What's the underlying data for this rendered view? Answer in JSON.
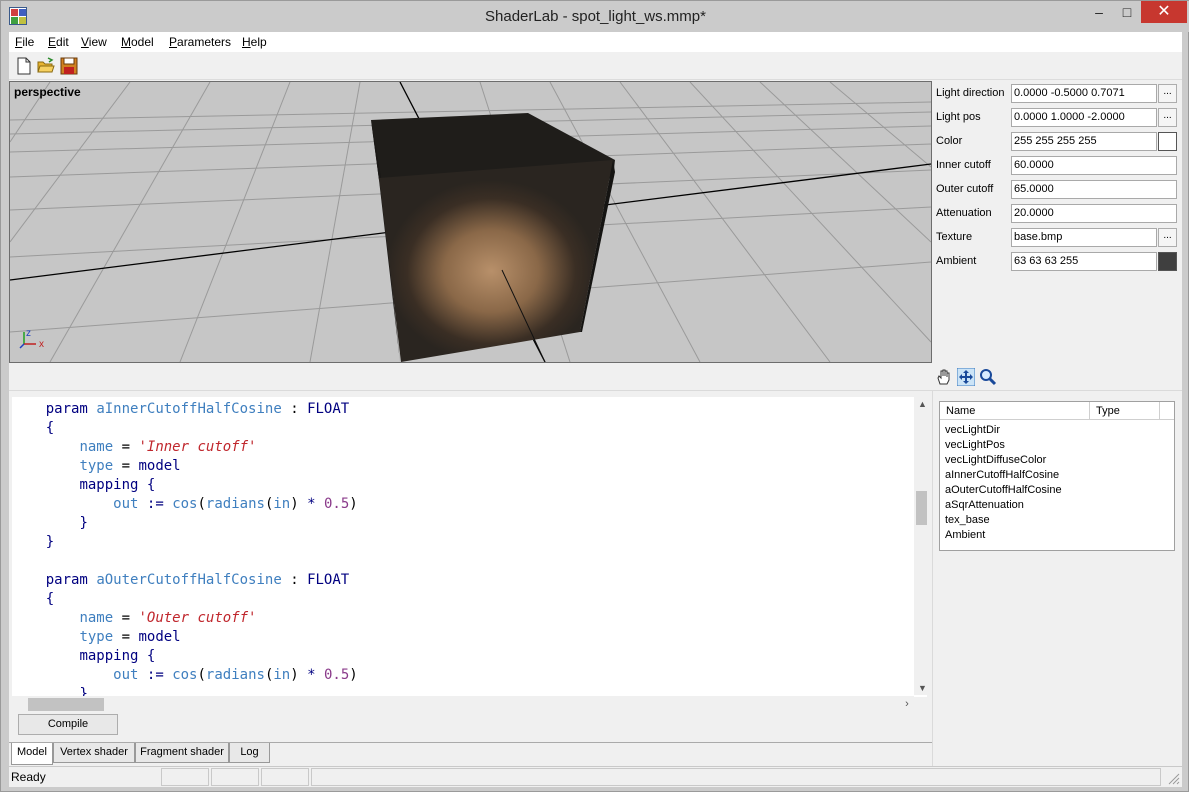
{
  "window": {
    "title": "ShaderLab - spot_light_ws.mmp*",
    "minimize": "–",
    "maximize": "□",
    "close": "✕"
  },
  "menu": {
    "file": "File",
    "edit": "Edit",
    "view": "View",
    "model": "Model",
    "parameters": "Parameters",
    "help": "Help"
  },
  "toolbar": {
    "icons": [
      "new-file-icon",
      "open-folder-icon",
      "save-disk-icon"
    ]
  },
  "viewport": {
    "label": "perspective",
    "axis_z": "z",
    "axis_x": "x",
    "background": "#c6c6c6"
  },
  "properties": {
    "rows": [
      {
        "label": "Light direction",
        "value": "0.0000 -0.5000 0.7071",
        "button": "..."
      },
      {
        "label": "Light pos",
        "value": "0.0000 1.0000 -2.0000",
        "button": "..."
      },
      {
        "label": "Color",
        "value": "255 255 255 255",
        "swatch": "#ffffff"
      },
      {
        "label": "Inner cutoff",
        "value": "60.0000"
      },
      {
        "label": "Outer cutoff",
        "value": "65.0000"
      },
      {
        "label": "Attenuation",
        "value": "20.0000"
      },
      {
        "label": "Texture",
        "value": "base.bmp",
        "button": "..."
      },
      {
        "label": "Ambient",
        "value": "63 63 63 255",
        "swatch": "#3f3f3f"
      }
    ]
  },
  "nav_tools": [
    "hand-pan-icon",
    "rotate-arrows-icon",
    "zoom-magnifier-icon"
  ],
  "code": {
    "block1_head": "param",
    "block1_name": "aInnerCutoffHalfCosine",
    "block1_sep": ":",
    "block1_type": "FLOAT",
    "block1_name_kw": "name",
    "block1_name_val": "'Inner cutoff'",
    "block1_type_kw": "type",
    "block1_type_val": "model",
    "block1_mapping": "mapping",
    "block2_head": "param",
    "block2_name": "aOuterCutoffHalfCosine",
    "block2_sep": ":",
    "block2_type": "FLOAT",
    "block2_name_kw": "name",
    "block2_name_val": "'Outer cutoff'",
    "block2_type_kw": "type",
    "block2_type_val": "model",
    "block2_mapping": "mapping",
    "out": "out",
    "assign": ":=",
    "cos": "cos",
    "radians": "radians",
    "in": "in",
    "mul": "*",
    "half": "0.5",
    "open_brace": "{",
    "close_brace": "}",
    "eq": "="
  },
  "compile_button": "Compile",
  "tabs": [
    "Model",
    "Vertex shader",
    "Fragment shader",
    "Log"
  ],
  "param_list": {
    "col_name": "Name",
    "col_type": "Type",
    "items": [
      "vecLightDir",
      "vecLightPos",
      "vecLightDiffuseColor",
      "aInnerCutoffHalfCosine",
      "aOuterCutoffHalfCosine",
      "aSqrAttenuation",
      "tex_base",
      "Ambient"
    ]
  },
  "status": {
    "text": "Ready"
  }
}
